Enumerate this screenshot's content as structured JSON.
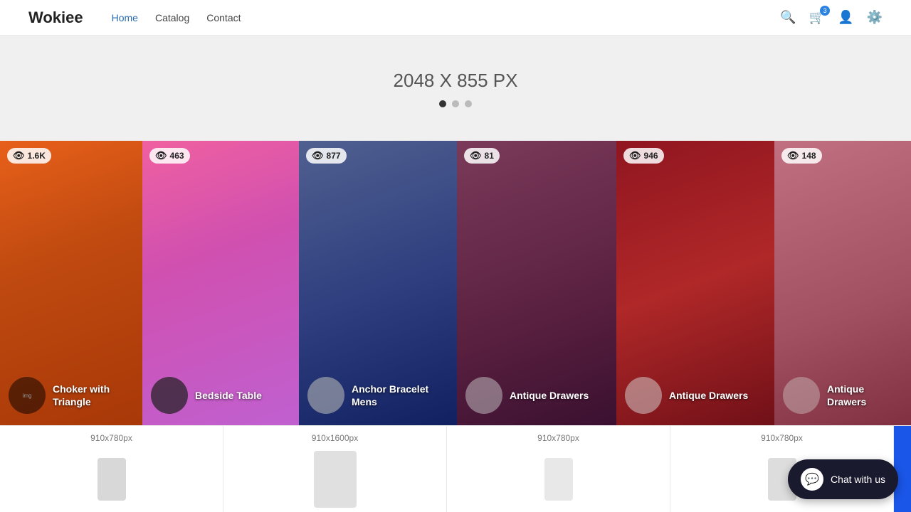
{
  "header": {
    "logo": "Wokiee",
    "nav": [
      {
        "label": "Home",
        "active": true
      },
      {
        "label": "Catalog",
        "active": false
      },
      {
        "label": "Contact",
        "active": false
      }
    ],
    "cart_count": "3"
  },
  "hero": {
    "title": "2048 X 855 PX",
    "dots": [
      {
        "active": true
      },
      {
        "active": false
      },
      {
        "active": false
      }
    ]
  },
  "cards": [
    {
      "id": 1,
      "views": "1.6K",
      "title": "Choker with Triangle",
      "width_class": "card-1",
      "color_hint": "orange saree"
    },
    {
      "id": 2,
      "views": "463",
      "title": "Bedside Table",
      "width_class": "card-2",
      "color_hint": "pink saree"
    },
    {
      "id": 3,
      "views": "877",
      "title": "Anchor Bracelet Mens",
      "width_class": "card-3",
      "color_hint": "blue saree"
    },
    {
      "id": 4,
      "views": "81",
      "title": "Antique Drawers",
      "width_class": "card-4",
      "color_hint": "purple close-up"
    },
    {
      "id": 5,
      "views": "946",
      "title": "Antique Drawers",
      "width_class": "card-5",
      "color_hint": "red saree"
    },
    {
      "id": 6,
      "views": "148",
      "title": "Antique Drawers",
      "width_class": "card-6",
      "color_hint": "pink saree cropped"
    }
  ],
  "bottom_row": [
    {
      "label": "910x780px"
    },
    {
      "label": "910x1600px"
    },
    {
      "label": "910x780px"
    },
    {
      "label": "910x780px"
    }
  ],
  "chat": {
    "label": "Chat with us"
  }
}
